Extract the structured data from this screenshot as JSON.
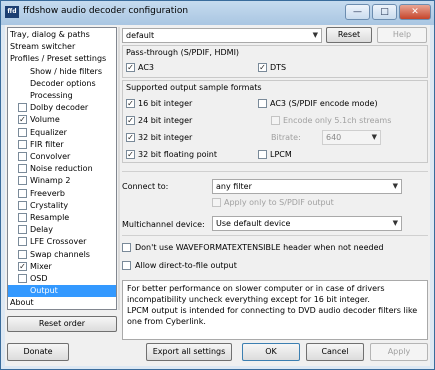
{
  "window": {
    "title": "ffdshow audio decoder configuration",
    "app_icon_text": "ffd"
  },
  "tree": {
    "items": [
      {
        "label": "Tray, dialog & paths",
        "indent": 0,
        "checkbox": false
      },
      {
        "label": "Stream switcher",
        "indent": 0,
        "checkbox": false
      },
      {
        "label": "Profiles / Preset settings",
        "indent": 0,
        "checkbox": false
      },
      {
        "label": "Show / hide filters",
        "indent": 1,
        "checkbox": false
      },
      {
        "label": "Decoder options",
        "indent": 1,
        "checkbox": false
      },
      {
        "label": "Processing",
        "indent": 1,
        "checkbox": false
      },
      {
        "label": "Dolby decoder",
        "indent": 1,
        "checkbox": true,
        "checked": false
      },
      {
        "label": "Volume",
        "indent": 1,
        "checkbox": true,
        "checked": true
      },
      {
        "label": "Equalizer",
        "indent": 1,
        "checkbox": true,
        "checked": false
      },
      {
        "label": "FIR filter",
        "indent": 1,
        "checkbox": true,
        "checked": false
      },
      {
        "label": "Convolver",
        "indent": 1,
        "checkbox": true,
        "checked": false
      },
      {
        "label": "Noise reduction",
        "indent": 1,
        "checkbox": true,
        "checked": false
      },
      {
        "label": "Winamp 2",
        "indent": 1,
        "checkbox": true,
        "checked": false
      },
      {
        "label": "Freeverb",
        "indent": 1,
        "checkbox": true,
        "checked": false
      },
      {
        "label": "Crystality",
        "indent": 1,
        "checkbox": true,
        "checked": false
      },
      {
        "label": "Resample",
        "indent": 1,
        "checkbox": true,
        "checked": false
      },
      {
        "label": "Delay",
        "indent": 1,
        "checkbox": true,
        "checked": false
      },
      {
        "label": "LFE Crossover",
        "indent": 1,
        "checkbox": true,
        "checked": false
      },
      {
        "label": "Swap channels",
        "indent": 1,
        "checkbox": true,
        "checked": false
      },
      {
        "label": "Mixer",
        "indent": 1,
        "checkbox": true,
        "checked": true
      },
      {
        "label": "OSD",
        "indent": 1,
        "checkbox": true,
        "checked": false
      },
      {
        "label": "Output",
        "indent": 1,
        "checkbox": false,
        "selected": true
      },
      {
        "label": "About",
        "indent": 0,
        "checkbox": false
      }
    ]
  },
  "preset": {
    "value": "default",
    "reset_label": "Reset",
    "help_label": "Help"
  },
  "passthrough": {
    "title": "Pass-through (S/PDIF, HDMI)",
    "ac3": "AC3",
    "dts": "DTS"
  },
  "formats": {
    "title": "Supported output sample formats",
    "int16": "16 bit integer",
    "int24": "24 bit integer",
    "int32": "32 bit integer",
    "float32": "32 bit floating point",
    "ac3_encode": "AC3 (S/PDIF encode mode)",
    "encode_51": "Encode only 5.1ch streams",
    "bitrate_label": "Bitrate:",
    "bitrate_value": "640",
    "lpcm": "LPCM"
  },
  "connect": {
    "label": "Connect to:",
    "value": "any filter",
    "spdif_only": "Apply only to S/PDIF output"
  },
  "multichannel": {
    "label": "Multichannel device:",
    "value": "Use default device"
  },
  "options": {
    "no_wfe": "Don't use WAVEFORMATEXTENSIBLE header when not needed",
    "direct_file": "Allow direct-to-file output"
  },
  "info_text": "For better performance on slower computer or in case of drivers incompatibility uncheck everything except for 16 bit integer.\nLPCM output is intended for connecting to DVD audio decoder filters like one from Cyberlink.",
  "buttons": {
    "reset_order": "Reset order",
    "donate": "Donate",
    "export": "Export all settings",
    "ok": "OK",
    "cancel": "Cancel",
    "apply": "Apply"
  },
  "window_controls": {
    "minimize": "—",
    "maximize": "□",
    "close": "✕"
  }
}
